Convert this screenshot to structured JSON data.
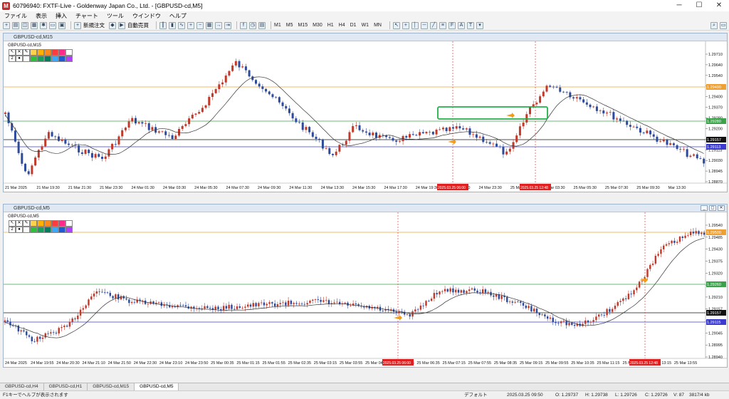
{
  "window": {
    "title": "60796940: FXTF-Live - Goldenway Japan Co., Ltd. - [GBPUSD-cd,M5]"
  },
  "menu": [
    "ファイル",
    "表示",
    "挿入",
    "チャート",
    "ツール",
    "ウインドウ",
    "ヘルプ"
  ],
  "toolbar": {
    "new_order": "新規注文",
    "auto_trade": "自動売買",
    "timeframes": [
      "M1",
      "M5",
      "M15",
      "M30",
      "H1",
      "H4",
      "D1",
      "W1",
      "MN"
    ]
  },
  "top_chart": {
    "title": "GBPUSD-cd,M15",
    "label": "GBPUSD-cd,M15",
    "price_labels": [
      "1.29710",
      "1.29640",
      "1.29540",
      "1.29480",
      "1.29400",
      "1.29370",
      "1.29280",
      "1.29200",
      "1.29157",
      "1.29113",
      "1.29030",
      "1.28945",
      "1.28870"
    ],
    "marker_prices": {
      "orange": "1.29490",
      "green": "1.29280",
      "black": "1.29157",
      "blue": "1.29113"
    },
    "time_labels": [
      "21 Mar 2025",
      "21 Mar 19:30",
      "21 Mar 21:30",
      "21 Mar 23:30",
      "24 Mar 01:30",
      "24 Mar 03:30",
      "24 Mar 05:30",
      "24 Mar 07:30",
      "24 Mar 09:30",
      "24 Mar 11:30",
      "24 Mar 13:30",
      "24 Mar 15:30",
      "24 Mar 17:30",
      "24 Mar 19:30",
      "24 Mar 21:30",
      "24 Mar 23:30",
      "25 Mar 01:30",
      "25 Mar 03:30",
      "25 Mar 05:30",
      "25 Mar 07:30",
      "25 Mar 09:30",
      "Mar 13:30"
    ],
    "red_time_labels": [
      "2025.03.25 06:00",
      "2025.03.25 12:48"
    ]
  },
  "bottom_chart": {
    "title": "GBPUSD-cd,M5",
    "label": "GBPUSD-cd,M5",
    "price_labels": [
      "1.29540",
      "1.29485",
      "1.29430",
      "1.29375",
      "1.29320",
      "1.29260",
      "1.29210",
      "1.29157",
      "1.29100",
      "1.29045",
      "1.28995",
      "1.28940"
    ],
    "marker_prices": {
      "orange": "1.29500",
      "green": "1.29260",
      "black": "1.29157",
      "blue": "1.29115"
    },
    "time_labels": [
      "24 Mar 2025",
      "24 Mar 19:55",
      "24 Mar 20:30",
      "24 Mar 21:10",
      "24 Mar 21:50",
      "24 Mar 22:30",
      "24 Mar 23:10",
      "24 Mar 23:50",
      "25 Mar 00:35",
      "25 Mar 01:15",
      "25 Mar 01:55",
      "25 Mar 02:35",
      "25 Mar 03:15",
      "25 Mar 03:55",
      "25 Mar 04:35",
      "25 Mar 05:15",
      "25 Mar 06:35",
      "25 Mar 07:15",
      "25 Mar 07:55",
      "25 Mar 08:35",
      "25 Mar 09:15",
      "25 Mar 09:55",
      "25 Mar 10:35",
      "25 Mar 11:15",
      "25 Mar 11:55",
      "25 Mar 13:15",
      "25 Mar 13:55"
    ],
    "red_time_labels": [
      "2025.03.25 06:00",
      "2025.03.25 12:48"
    ]
  },
  "palette": {
    "row1": [
      "↖",
      "✕",
      "✎"
    ],
    "row2": [
      "2",
      "●"
    ]
  },
  "tabs": [
    "GBPUSD-cd,H4",
    "GBPUSD-cd,H1",
    "GBPUSD-cd,M15",
    "GBPUSD-cd,M5"
  ],
  "status": {
    "help": "F1キーでヘルプが表示されます",
    "profile": "デフォルト",
    "datetime": "2025.03.25 09:50",
    "open": "O: 1.29737",
    "high": "H: 1.29738",
    "low": "L: 1.29726",
    "close": "C: 1.29726",
    "volume": "V: 87",
    "traffic": "3817/4 kb"
  },
  "colors": {
    "bull": "#c0392b",
    "bear": "#2e4a9c",
    "ma": "#333333",
    "orange_line": "#f0a030",
    "green_line": "#3aa34a",
    "blue_line": "#3b3bd0",
    "black_line": "#111111",
    "red_vline": "#e04040"
  }
}
